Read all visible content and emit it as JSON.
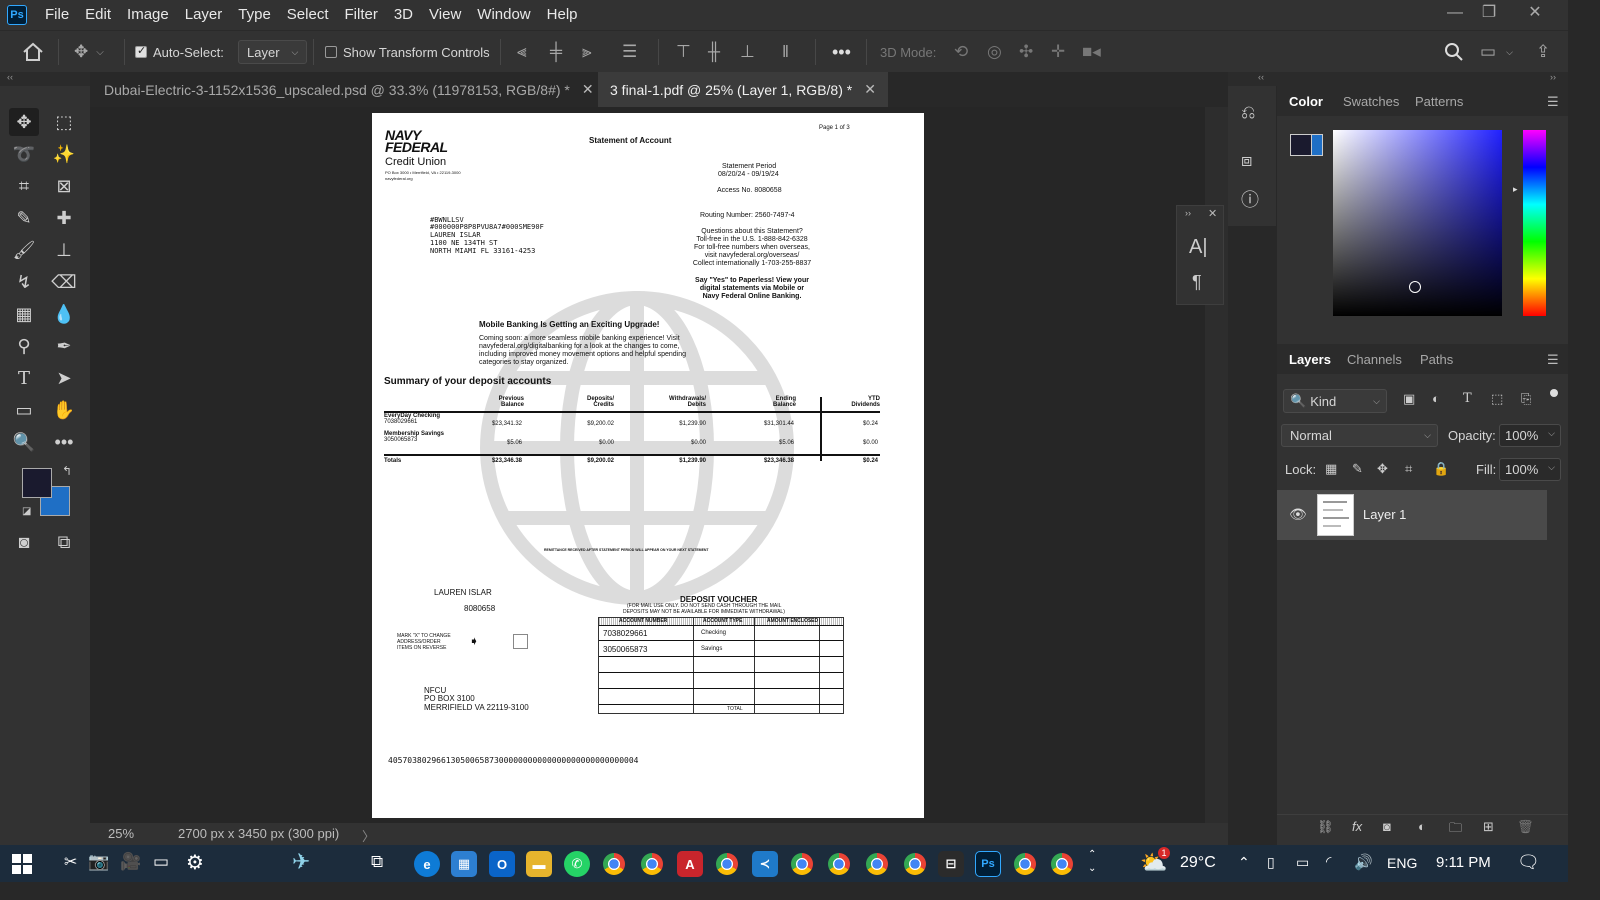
{
  "menubar": {
    "items": [
      "File",
      "Edit",
      "Image",
      "Layer",
      "Type",
      "Select",
      "Filter",
      "3D",
      "View",
      "Window",
      "Help"
    ]
  },
  "options": {
    "auto_select_label": "Auto-Select:",
    "auto_select_target": "Layer",
    "show_transform_label": "Show Transform Controls",
    "mode3d_label": "3D Mode:"
  },
  "tabs": [
    {
      "label": "Dubai-Electric-3-1152x1536_upscaled.psd @ 33.3% (11978153, RGB/8#) *"
    },
    {
      "label": "3 final-1.pdf @ 25% (Layer 1, RGB/8) *"
    }
  ],
  "status": {
    "zoom": "25%",
    "dims": "2700 px x 3450 px (300 ppi)"
  },
  "document": {
    "page": "Page 1 of 3",
    "title": "Statement of Account",
    "logo_line1": "NAVY",
    "logo_line2": "FEDERAL",
    "logo_line3": "Credit Union",
    "logo_addr": "PO Box 3000 • Merrifield, VA • 22119-3000",
    "logo_web": "navyfederal.org",
    "period_label": "Statement Period",
    "period": "08/20/24 - 09/19/24",
    "access": "Access No. 8080658",
    "routing": "Routing Number: 2560-7497-4",
    "addr1": "#BWNLLSV",
    "addr2": "#000000P8P8PVU8A7#000SME90F",
    "addr3": "LAUREN ISLAR",
    "addr4": "1100 NE 134TH ST",
    "addr5": "NORTH MIAMI FL 33161-4253",
    "q1": "Questions about this Statement?",
    "q2": "Toll-free in the U.S. 1-888-842-6328",
    "q3": "For toll-free numbers when overseas,",
    "q4": "visit navyfederal.org/overseas/",
    "q5": "Collect internationally 1-703-255-8837",
    "p1": "Say \"Yes\" to Paperless! View your",
    "p2": "digital statements via Mobile or",
    "p3": "Navy Federal Online Banking.",
    "mb_title": "Mobile Banking Is Getting an Exciting Upgrade!",
    "mb1": "Coming soon: a more seamless mobile banking experience! Visit",
    "mb2": "navyfederal.org/digitalbanking for a look at the changes to come,",
    "mb3": "including improved money movement options and helpful spending",
    "mb4": "categories to stay organized.",
    "summary_title": "Summary of your deposit accounts",
    "col_prev": "Previous Balance",
    "col_dep": "Deposits/ Credits",
    "col_wd": "Withdrawals/ Debits",
    "col_end": "Ending Balance",
    "col_ytd": "YTD Dividends",
    "rows": [
      {
        "name": "EveryDay Checking",
        "acct": "7038029661",
        "prev": "$23,341.32",
        "dep": "$9,200.02",
        "wd": "$1,239.90",
        "end": "$31,301.44",
        "ytd": "$0.24"
      },
      {
        "name": "Membership Savings",
        "acct": "3050065873",
        "prev": "$5.06",
        "dep": "$0.00",
        "wd": "$0.00",
        "end": "$5.06",
        "ytd": "$0.00"
      }
    ],
    "totals": {
      "label": "Totals",
      "prev": "$23,346.38",
      "dep": "$9,200.02",
      "wd": "$1,239.90",
      "end": "$23,346.38",
      "ytd": "$0.24"
    },
    "remit": "REMITTANCE RECEIVED AFTER STATEMENT PERIOD WILL APPEAR ON YOUR NEXT STATEMENT",
    "v_name": "LAUREN ISLAR",
    "v_acct": "8080658",
    "v_title": "DEPOSIT VOUCHER",
    "v_sub1": "(FOR MAIL USE ONLY. DO NOT SEND CASH THROUGH THE MAIL",
    "v_sub2": "DEPOSITS MAY NOT BE AVAILABLE FOR IMMEDIATE WITHDRAWAL)",
    "v_mark1": "MARK \"X\" TO CHANGE",
    "v_mark2": "ADDRESS/ORDER",
    "v_mark3": "ITEMS ON REVERSE",
    "v_h1": "ACCOUNT NUMBER",
    "v_h2": "ACCOUNT TYPE",
    "v_h3": "AMOUNT ENCLOSED",
    "v_r1a": "7038029661",
    "v_r1b": "Checking",
    "v_r2a": "3050065873",
    "v_r2b": "Savings",
    "v_total": "TOTAL",
    "nfcu1": "NFCU",
    "nfcu2": "PO BOX 3100",
    "nfcu3": "MERRIFIELD VA 22119-3100",
    "micr": "4057038029661305006587300000000000000000000000000004"
  },
  "color_panel": {
    "tabs": [
      "Color",
      "Swatches",
      "Patterns"
    ],
    "fg": "#1a1a2e",
    "bg": "#1f6fc5"
  },
  "layers_panel": {
    "tabs": [
      "Layers",
      "Channels",
      "Paths"
    ],
    "kind": "Kind",
    "blend": "Normal",
    "opacity_label": "Opacity:",
    "opacity": "100%",
    "lock_label": "Lock:",
    "fill_label": "Fill:",
    "fill": "100%",
    "layer_name": "Layer 1"
  },
  "taskbar": {
    "temp": "29°C",
    "lang": "ENG",
    "time": "9:11 PM",
    "notif": "1"
  }
}
